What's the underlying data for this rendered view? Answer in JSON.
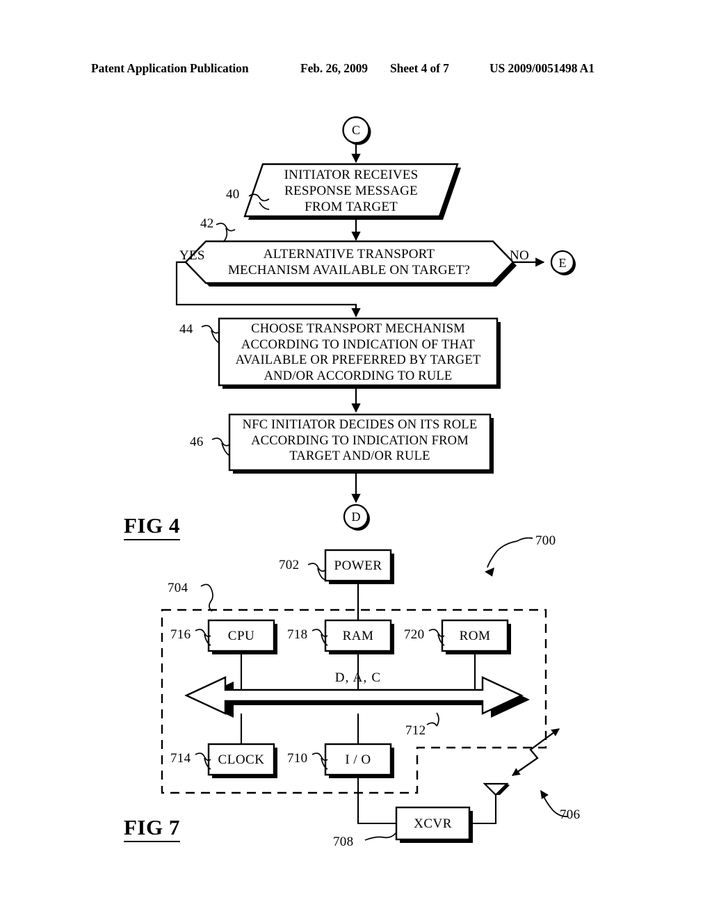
{
  "header": {
    "publication": "Patent Application Publication",
    "date": "Feb. 26, 2009",
    "sheet": "Sheet 4 of 7",
    "patent_number": "US 2009/0051498 A1"
  },
  "figures": [
    {
      "id": "fig4",
      "label": "FIG 4",
      "type": "flowchart",
      "connectors_in": [
        {
          "name": "connector-c",
          "letter": "C"
        }
      ],
      "connectors_out": [
        {
          "name": "connector-e",
          "letter": "E"
        },
        {
          "name": "connector-d",
          "letter": "D"
        }
      ],
      "nodes": [
        {
          "ref": "40",
          "shape": "parallelogram",
          "lines": [
            "INITIATOR RECEIVES",
            "RESPONSE MESSAGE",
            "FROM TARGET"
          ]
        },
        {
          "ref": "42",
          "shape": "decision",
          "lines": [
            "ALTERNATIVE TRANSPORT",
            "MECHANISM AVAILABLE ON TARGET?"
          ],
          "branch_yes": "YES",
          "branch_no": "NO"
        },
        {
          "ref": "44",
          "shape": "process",
          "lines": [
            "CHOOSE TRANSPORT MECHANISM",
            "ACCORDING TO INDICATION OF THAT",
            "AVAILABLE OR PREFERRED BY TARGET",
            "AND/OR ACCORDING TO RULE"
          ]
        },
        {
          "ref": "46",
          "shape": "process",
          "lines": [
            "NFC INITIATOR DECIDES ON ITS ROLE",
            "ACCORDING TO INDICATION FROM",
            "TARGET AND/OR RULE"
          ]
        }
      ]
    },
    {
      "id": "fig7",
      "label": "FIG 7",
      "type": "block-diagram",
      "system_ref": "700",
      "enclosure_ref": "704",
      "bus_ref": "712",
      "bus_label": "D, A, C",
      "rf_ref": "706",
      "blocks": [
        {
          "ref": "702",
          "label": "POWER"
        },
        {
          "ref": "716",
          "label": "CPU"
        },
        {
          "ref": "718",
          "label": "RAM"
        },
        {
          "ref": "720",
          "label": "ROM"
        },
        {
          "ref": "714",
          "label": "CLOCK"
        },
        {
          "ref": "710",
          "label": "I / O"
        },
        {
          "ref": "708",
          "label": "XCVR"
        }
      ]
    }
  ]
}
